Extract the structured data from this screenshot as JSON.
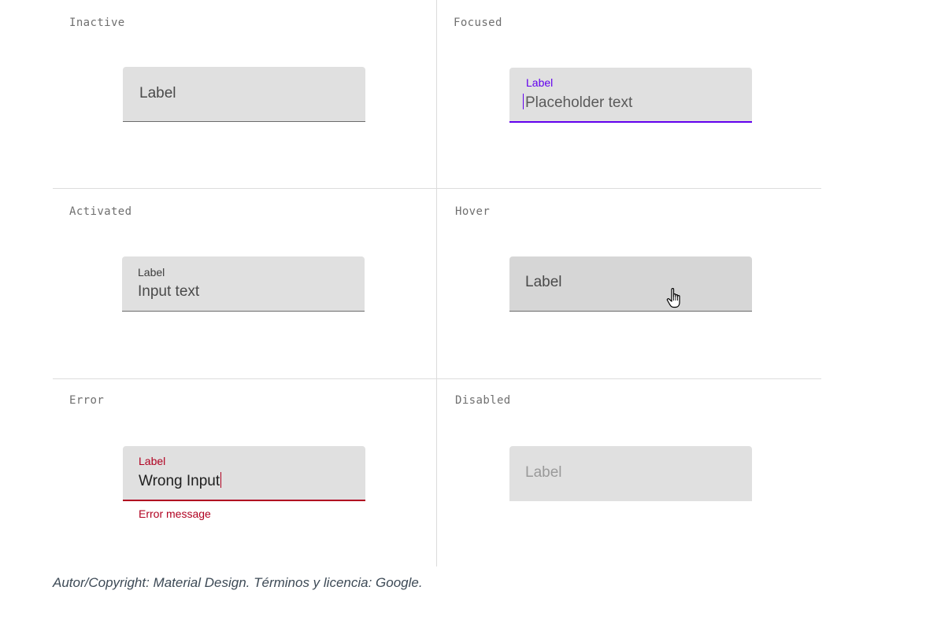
{
  "states": {
    "inactive": {
      "title": "Inactive",
      "label": "Label"
    },
    "focused": {
      "title": "Focused",
      "label": "Label",
      "placeholder": "Placeholder text",
      "accent": "#6200ee"
    },
    "activated": {
      "title": "Activated",
      "label": "Label",
      "value": "Input text"
    },
    "hover": {
      "title": "Hover",
      "label": "Label"
    },
    "error": {
      "title": "Error",
      "label": "Label",
      "value": "Wrong Input",
      "helper": "Error message",
      "error_color": "#b00020"
    },
    "disabled": {
      "title": "Disabled",
      "label": "Label"
    }
  },
  "icons": {
    "hover_cursor": "hand-pointer-icon"
  },
  "caption": "Autor/Copyright: Material Design. Términos y licencia: Google."
}
